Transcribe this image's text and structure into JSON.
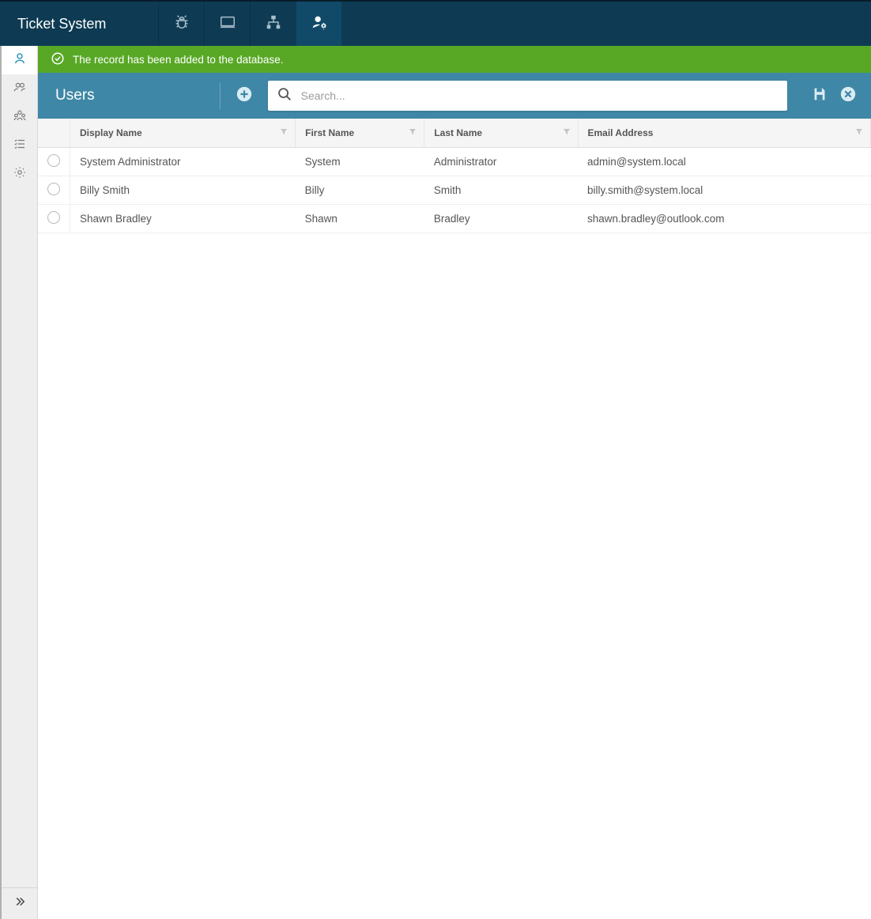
{
  "app": {
    "title": "Ticket System"
  },
  "topnav": {
    "items": [
      "bug",
      "desktop",
      "org",
      "user-admin"
    ],
    "active_index": 3
  },
  "sidebar": {
    "items": [
      "user",
      "users",
      "team",
      "checklist",
      "gear"
    ],
    "active_index": 0
  },
  "banner": {
    "message": "The record has been added to the database."
  },
  "page": {
    "title": "Users",
    "search_placeholder": "Search..."
  },
  "table": {
    "columns": [
      {
        "label": "Display Name"
      },
      {
        "label": "First Name"
      },
      {
        "label": "Last Name"
      },
      {
        "label": "Email Address"
      }
    ],
    "rows": [
      {
        "display_name": "System Administrator",
        "first_name": "System",
        "last_name": "Administrator",
        "email": "admin@system.local"
      },
      {
        "display_name": "Billy Smith",
        "first_name": "Billy",
        "last_name": "Smith",
        "email": "billy.smith@system.local"
      },
      {
        "display_name": "Shawn Bradley",
        "first_name": "Shawn",
        "last_name": "Bradley",
        "email": "shawn.bradley@outlook.com"
      }
    ]
  }
}
